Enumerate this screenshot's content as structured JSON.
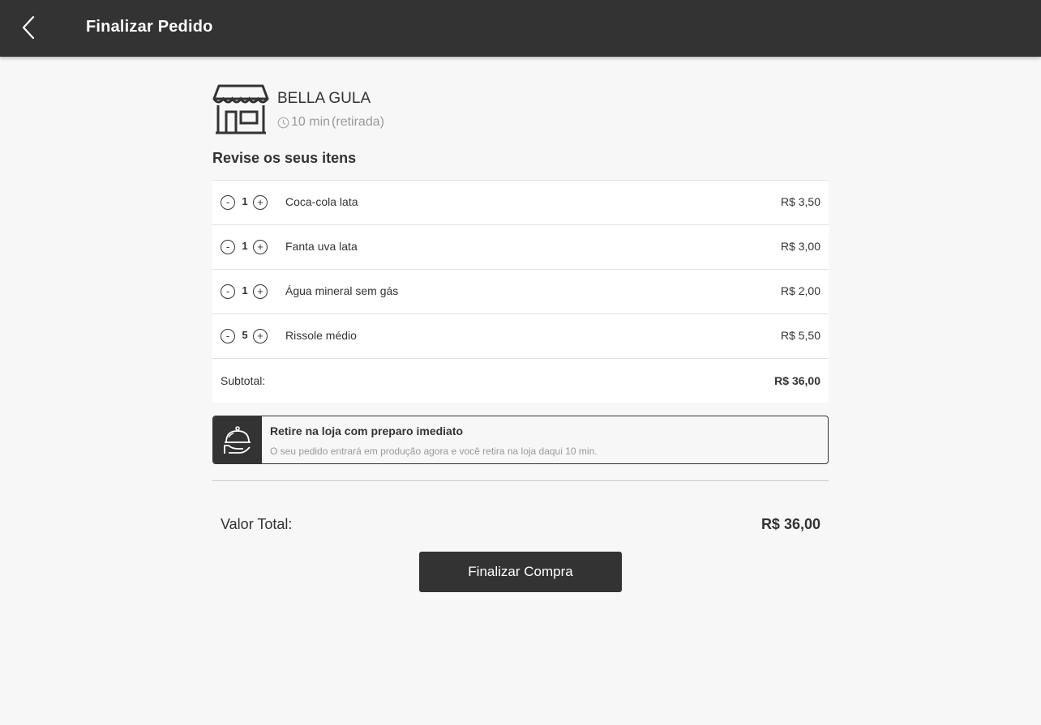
{
  "header": {
    "title": "Finalizar Pedido",
    "back_icon": "chevron-left-icon"
  },
  "store": {
    "icon": "storefront-icon",
    "name": "BELLA GULA",
    "time": "10 min",
    "mode": "(retirada)"
  },
  "section_title": "Revise os seus itens",
  "items": [
    {
      "qty": "1",
      "name": "Coca-cola lata",
      "price": "R$ 3,50"
    },
    {
      "qty": "1",
      "name": "Fanta uva lata",
      "price": "R$ 3,00"
    },
    {
      "qty": "1",
      "name": "Água mineral sem gás",
      "price": "R$ 2,00"
    },
    {
      "qty": "5",
      "name": "Rissole médio",
      "price": "R$ 5,50"
    }
  ],
  "qty_controls": {
    "minus": "-",
    "plus": "+"
  },
  "subtotal": {
    "label": "Subtotal:",
    "value": "R$ 36,00"
  },
  "pickup": {
    "icon": "cloche-serving-icon",
    "title": "Retire na loja com preparo imediato",
    "description": "O seu pedido entrará em produção agora e você retira na loja daqui 10 min."
  },
  "total": {
    "label": "Valor Total:",
    "value": "R$ 36,00"
  },
  "finish_button": "Finalizar Compra"
}
